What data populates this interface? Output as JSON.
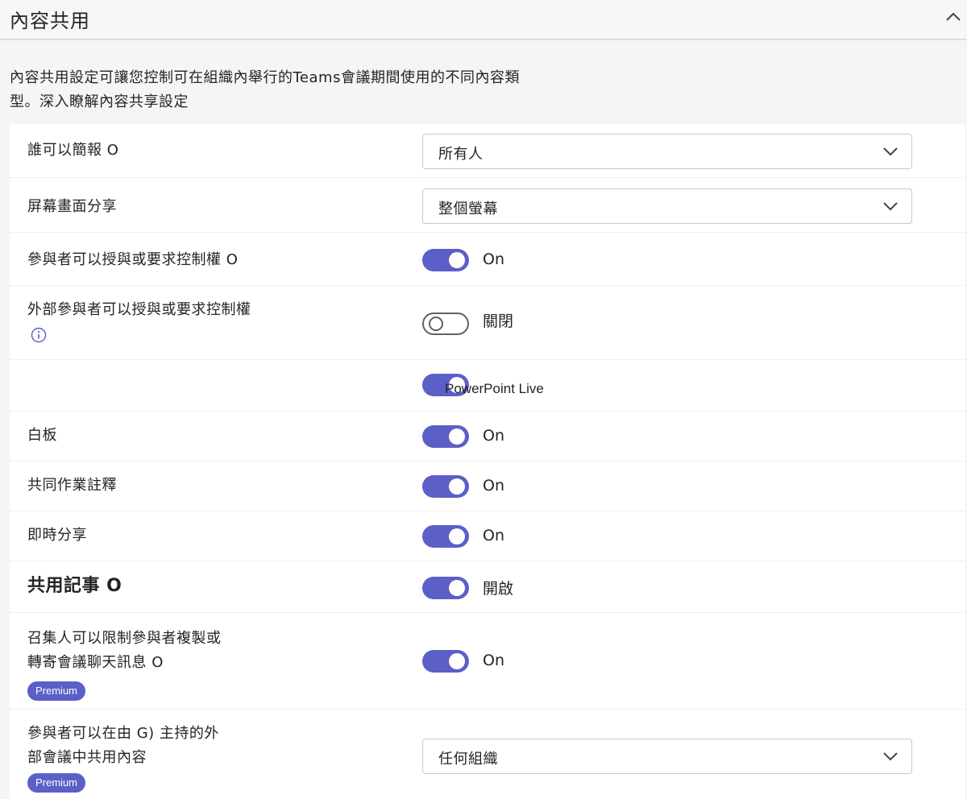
{
  "header": {
    "title": "內容共用"
  },
  "description": "內容共用設定可讓您控制可在組織內舉行的Teams會議期間使用的不同內容類型。深入瞭解內容共享設定",
  "settings": {
    "presenter": {
      "label": "誰可以簡報 O",
      "value": "所有人"
    },
    "screen_share": {
      "label": "屏幕畫面分享",
      "value": "整個螢幕"
    },
    "give_control": {
      "label": "參與者可以授與或要求控制權 O",
      "state": "On"
    },
    "external_control": {
      "label": "外部參與者可以授與或要求控制權",
      "state": "關閉"
    },
    "powerpoint": {
      "label": "PowerPoint Live"
    },
    "whiteboard": {
      "label": "白板",
      "state": "On"
    },
    "annotations": {
      "label": "共同作業註釋",
      "state": "On"
    },
    "live_share": {
      "label": "即時分享",
      "state": "On"
    },
    "shared_notes": {
      "label": "共用記事 O",
      "state": "開啟"
    },
    "restrict_copy": {
      "label_line1": "召集人可以限制參與者複製或",
      "label_line2": "轉寄會議聊天訊息 O",
      "badge": "Premium",
      "state": "On"
    },
    "external_share": {
      "label_line1": "參與者可以在由 G) 主持的外",
      "label_line2": "部會議中共用內容",
      "badge": "Premium",
      "value": "任何組織"
    }
  },
  "colors": {
    "accent": "#5b5fc7"
  }
}
